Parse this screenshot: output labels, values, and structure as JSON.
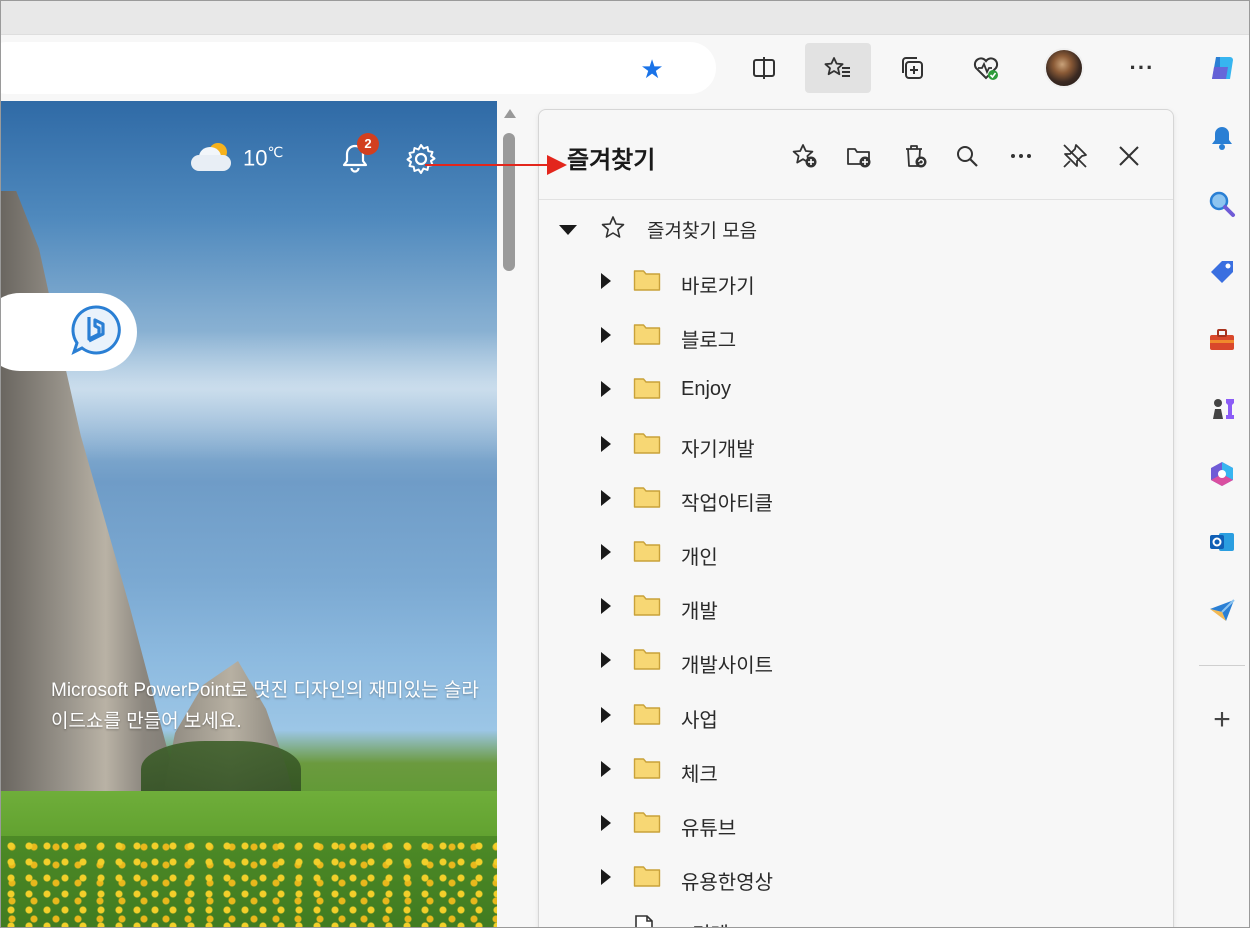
{
  "toolbar": {
    "split_screen": "split-screen-icon",
    "favorites": "favorites-list-icon",
    "collections": "collections-icon",
    "browser_essentials": "health-heart-icon",
    "profile": "profile-avatar",
    "more": "···"
  },
  "ntp": {
    "weather_temp": "10",
    "weather_unit": "℃",
    "notification_count": "2",
    "caption": "Microsoft PowerPoint로 멋진 디자인의 재미있는 슬라이드쇼를 만들어 보세요."
  },
  "favorites_panel": {
    "title": "즐겨찾기",
    "actions": [
      "add-favorite-icon",
      "add-folder-icon",
      "trash-icon",
      "search-icon",
      "more-icon",
      "pin-icon",
      "close-icon"
    ],
    "root_label": "즐겨찾기 모음",
    "folders": [
      {
        "label": "바로가기"
      },
      {
        "label": "블로그"
      },
      {
        "label": "Enjoy"
      },
      {
        "label": "자기개발"
      },
      {
        "label": "작업아티클"
      },
      {
        "label": "개인"
      },
      {
        "label": "개발"
      },
      {
        "label": "개발사이트"
      },
      {
        "label": "사업"
      },
      {
        "label": "체크"
      },
      {
        "label": "유튜브"
      },
      {
        "label": "유용한영상"
      }
    ],
    "partial_item": "o미레"
  },
  "sidebar": {
    "items": [
      "copilot-icon",
      "bell-icon",
      "search-icon",
      "tag-icon",
      "toolbox-icon",
      "chess-icon",
      "office-icon",
      "outlook-icon",
      "send-icon"
    ],
    "add": "+"
  },
  "colors": {
    "accent_blue": "#1a73e8",
    "badge_red": "#d23f1f",
    "arrow_red": "#e3261c",
    "folder_yellow": "#f7d774"
  }
}
